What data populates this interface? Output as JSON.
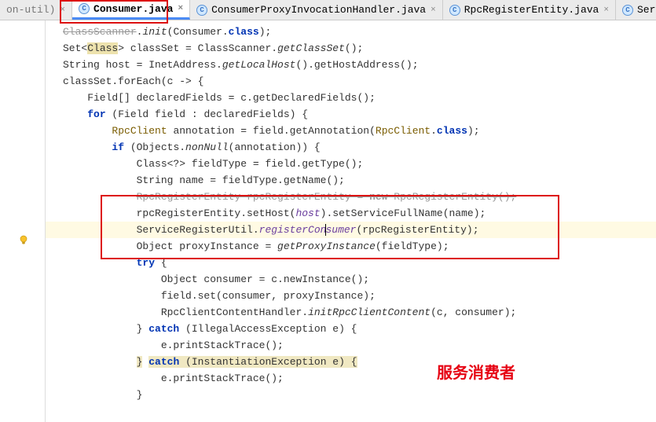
{
  "tabs": {
    "frag": "on-util)",
    "t1": "Consumer.java",
    "t2": "ConsumerProxyInvocationHandler.java",
    "t3": "RpcRegisterEntity.java",
    "t4": "ServiceRegister"
  },
  "code": {
    "l1a": "ClassScanner",
    "l1b": ".",
    "l1c": "init",
    "l1d": "(Consumer.",
    "l1e": "class",
    "l1f": ");",
    "l2a": "Set<",
    "l2b": "Class",
    "l2c": "> classSet = ClassScanner.",
    "l2d": "getClassSet",
    "l2e": "();",
    "l3a": "String host = InetAddress.",
    "l3b": "getLocalHost",
    "l3c": "().getHostAddress();",
    "l4": "classSet.forEach(c -> {",
    "l5": "    Field[] declaredFields = c.getDeclaredFields();",
    "l6a": "    ",
    "l6b": "for",
    "l6c": " (Field field : declaredFields) {",
    "l7a": "        ",
    "l7b": "RpcClient",
    "l7c": " annotation = field.getAnnotation(",
    "l7d": "RpcClient",
    "l7e": ".",
    "l7f": "class",
    "l7g": ");",
    "l8a": "        ",
    "l8b": "if",
    "l8c": " (Objects.",
    "l8d": "nonNull",
    "l8e": "(annotation)) {",
    "l9": "            Class<?> fieldType = field.getType();",
    "l10": "            String name = fieldType.getName();",
    "l11a": "            ",
    "l11b": "RpcRegisterEntity rpcRegisterEntity = ",
    "l11c": "new",
    "l11d": " RpcRegisterEntity();",
    "l12a": "            rpcRegisterEntity.setHost(",
    "l12b": "host",
    "l12c": ").setServiceFullName(name);",
    "l13a": "            ServiceRegisterUtil.",
    "l13b": "registerCon",
    "l13c": "sumer",
    "l13d": "(rpcRegisterEntity);",
    "l14a": "            Object proxyInstance = ",
    "l14b": "getProxyInstance",
    "l14c": "(fieldType);",
    "l15a": "            ",
    "l15b": "try",
    "l15c": " {",
    "l16": "                Object consumer = c.newInstance();",
    "l17": "                field.set(consumer, proxyInstance);",
    "l18a": "                RpcClientContentHandler.",
    "l18b": "initRpcClientContent",
    "l18c": "(c, consumer);",
    "l19a": "            } ",
    "l19b": "catch",
    "l19c": " (IllegalAccessException e) {",
    "l20": "                e.printStackTrace();",
    "l21a": "            ",
    "l21b": "}",
    "l21c": " ",
    "l21d": "catch",
    "l21e": " (",
    "l21f": "InstantiationException e",
    "l21g": ") {",
    "l22": "                e.printStackTrace();",
    "l23": "            }"
  },
  "annotation": "服务消费者"
}
